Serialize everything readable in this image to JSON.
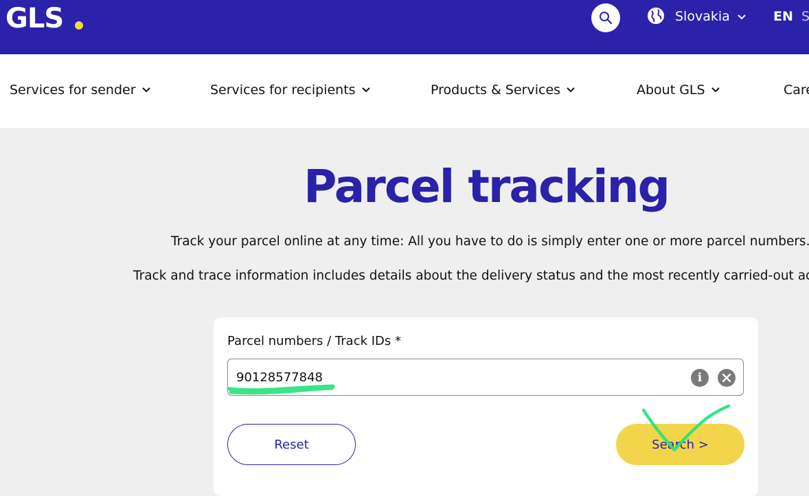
{
  "header": {
    "logo_text": "GLS",
    "logo_dot_color": "#f3d54b",
    "brand_color": "#2a22a8",
    "search_icon": "search-icon",
    "country_icon": "globe-icon",
    "country": "Slovakia",
    "languages": [
      "EN",
      "S"
    ]
  },
  "nav": {
    "items": [
      {
        "label": "Services for sender"
      },
      {
        "label": "Services for recipients"
      },
      {
        "label": "Products & Services"
      },
      {
        "label": "About GLS"
      },
      {
        "label": "Care"
      }
    ]
  },
  "main": {
    "title": "Parcel tracking",
    "paragraph1": "Track your parcel online at any time: All you have to do is simply enter one or more parcel numbers.",
    "paragraph2": "Track and trace information includes details about the delivery status and the most recently carried-out ac"
  },
  "tracking_form": {
    "field_label": "Parcel numbers / Track IDs *",
    "input_value": "90128577848",
    "info_icon": "i",
    "reset_label": "Reset",
    "search_label": "Search >",
    "accent_color": "#f3d54b"
  },
  "annotations": {
    "color": "#22e27a"
  }
}
